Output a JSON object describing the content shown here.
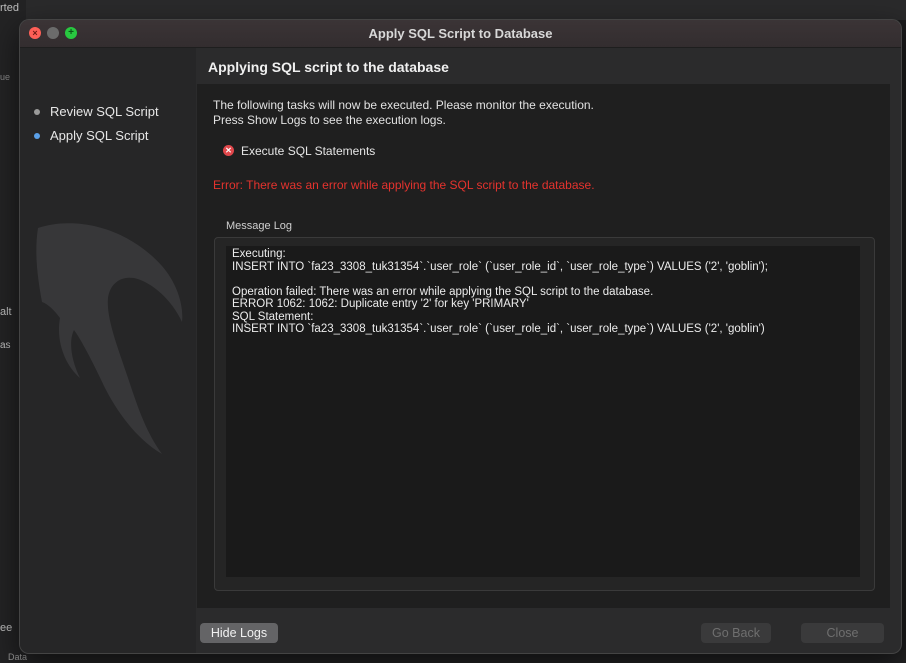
{
  "background_app": {
    "fragments": [
      "rted",
      "ue",
      "alt",
      "as",
      "ee",
      "Data"
    ]
  },
  "window": {
    "title": "Apply SQL Script to Database"
  },
  "sidebar": {
    "steps": [
      {
        "label": "Review SQL Script",
        "state": "done"
      },
      {
        "label": "Apply SQL Script",
        "state": "current"
      }
    ]
  },
  "main": {
    "heading": "Applying SQL script to the database",
    "description_line1": "The following tasks will now be executed. Please monitor the execution.",
    "description_line2": "Press Show Logs to see the execution logs.",
    "task": {
      "label": "Execute SQL Statements",
      "status": "error"
    },
    "error_message": "Error: There was an error while applying the SQL script to the database.",
    "message_log_label": "Message Log",
    "log_text": "Executing:\nINSERT INTO `fa23_3308_tuk31354`.`user_role` (`user_role_id`, `user_role_type`) VALUES ('2', 'goblin');\n\nOperation failed: There was an error while applying the SQL script to the database.\nERROR 1062: 1062: Duplicate entry '2' for key 'PRIMARY'\nSQL Statement:\nINSERT INTO `fa23_3308_tuk31354`.`user_role` (`user_role_id`, `user_role_type`) VALUES ('2', 'goblin')"
  },
  "footer": {
    "hide_logs": "Hide Logs",
    "go_back": "Go Back",
    "close": "Close"
  },
  "colors": {
    "error": "#e5332e",
    "current_step": "#5aa0e8",
    "close_button": "#ff5f57",
    "zoom_button": "#28c840"
  },
  "icons": {
    "task_status": "error-x-icon",
    "logo": "mysql-dolphin-icon"
  }
}
